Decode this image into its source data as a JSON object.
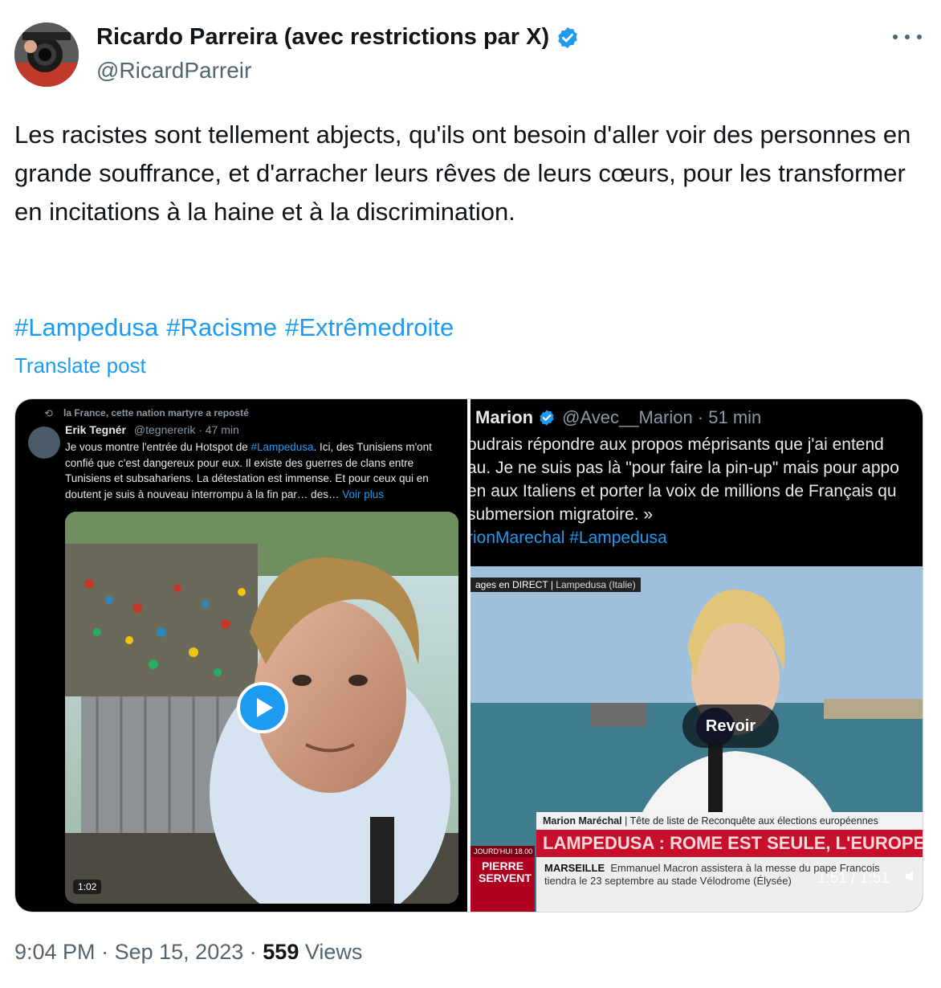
{
  "author": {
    "name": "Ricardo Parreira (avec restrictions par X)",
    "handle": "@RicardParreir"
  },
  "tweet": {
    "text": "Les racistes sont tellement abjects, qu'ils ont besoin d'aller voir des personnes en grande souffrance, et d'arracher leurs rêves de leurs cœurs, pour les transformer en incitations à la haine et à la discrimination.",
    "hashtags": [
      "#Lampedusa",
      "#Racisme",
      "#Extrêmedroite"
    ],
    "translate_label": "Translate post"
  },
  "media_left": {
    "repost_label": "la France, cette nation martyre a reposté",
    "name": "Erik Tegnér",
    "handle_time": "@tegnererik · 47 min",
    "text_before": "Je vous montre l'entrée du Hotspot de ",
    "text_hashtag": "#Lampedusa",
    "text_after": ". Ici, des Tunisiens m'ont confié que c'est dangereux pour eux. Il existe des guerres de clans entre Tunisiens et subsahariens. La détestation est immense. Et pour ceux qui en doutent je suis à nouveau interrompu à la fin par… des…",
    "see_more": "Voir plus",
    "duration": "1:02"
  },
  "media_right": {
    "name": "Marion",
    "handle_time": "@Avec__Marion · 51 min",
    "lines": [
      "oudrais répondre aux propos méprisants que j'ai entend",
      "au. Je ne suis pas là \"pour faire la pin-up\" mais pour appo",
      "en aux Italiens et porter la voix de millions de Français qu",
      " submersion migratoire. »"
    ],
    "hashtags_line": "rionMarechal #Lampedusa",
    "direct_label": "ages en DIRECT",
    "direct_location": "Lampedusa (Italie)",
    "person_name": "Marion Maréchal",
    "person_title": "Tête de liste de Reconquête aux élections européennes",
    "headline": "LAMPEDUSA : ROME EST SEULE, L'EUROPE EST M",
    "today_label": "JOURD'HUI 18.00",
    "today_show": "PIERRE SERVENT",
    "ticker_city": "MARSEILLE",
    "ticker_text": "Emmanuel Macron assistera à la messe du pape François",
    "ticker_text2": "tiendra le 23 septembre au stade Vélodrome (Élysée)",
    "replay_label": "Revoir",
    "duration": "1:51 / 1:51"
  },
  "meta": {
    "time": "9:04 PM",
    "date": "Sep 15, 2023",
    "views_count": "559",
    "views_label": "Views",
    "separator": "·"
  },
  "colors": {
    "link": "#1d9bf0",
    "muted": "#536471",
    "text": "#0f1419"
  }
}
